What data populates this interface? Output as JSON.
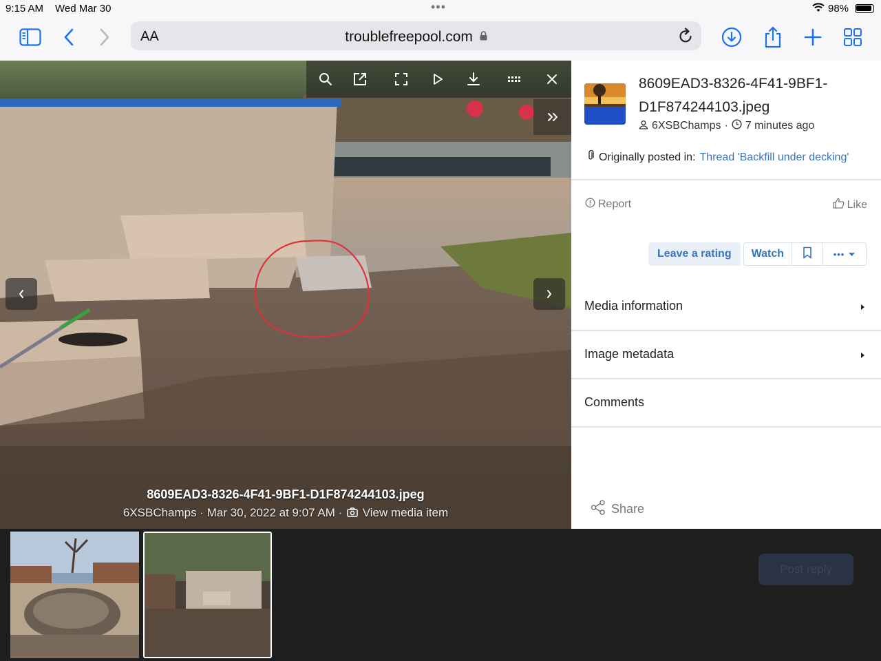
{
  "status": {
    "time": "9:15 AM",
    "date": "Wed Mar 30",
    "battery": "98%"
  },
  "browser": {
    "aa": "AA",
    "url": "troublefreepool.com"
  },
  "viewer": {
    "filename": "8609EAD3-8326-4F41-9BF1-D1F874244103.jpeg",
    "meta": "6XSBChamps · Mar 30, 2022 at 9:07 AM ·",
    "view_media": "View media item"
  },
  "sidebar": {
    "title": "8609EAD3-8326-4F41-9BF1-D1F874244103.jpeg",
    "author": "6XSBChamps",
    "sep": "·",
    "time_ago": "7 minutes ago",
    "posted_label": "Originally posted in:",
    "posted_link": "Thread 'Backfill under decking'",
    "report": "Report",
    "like": "Like",
    "leave_rating": "Leave a rating",
    "watch": "Watch",
    "more": "•••",
    "sections": [
      "Media information",
      "Image metadata",
      "Comments"
    ],
    "share": "Share"
  },
  "background": {
    "post_reply": "Post reply"
  },
  "colors": {
    "accent": "#3b73b9",
    "chrome_blue": "#1a73e8",
    "circle_red": "#e0303a"
  }
}
